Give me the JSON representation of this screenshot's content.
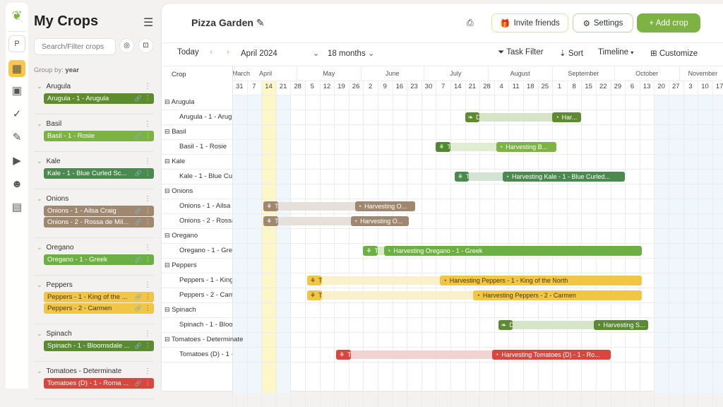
{
  "sidebar_rail": {
    "icons": [
      "sprout-logo-icon",
      "calendar-icon",
      "dashboard-icon",
      "check-circle-icon",
      "edit-icon",
      "video-tutorial-icon",
      "community-icon",
      "shop-icon"
    ],
    "profile_initial": "P"
  },
  "panel": {
    "title": "My Crops",
    "search_placeholder": "Search/Filter crops",
    "group_by_label": "Group by:",
    "group_by_value": "year",
    "groups": [
      {
        "name": "Arugula",
        "items": [
          {
            "label": "Arugula - 1 - Arugula",
            "color": "#5f8b2f"
          }
        ]
      },
      {
        "name": "Basil",
        "items": [
          {
            "label": "Basil - 1 - Rosie",
            "color": "#7cb342"
          }
        ]
      },
      {
        "name": "Kale",
        "items": [
          {
            "label": "Kale - 1 - Blue Curled Sc...",
            "color": "#4a8a4e"
          }
        ]
      },
      {
        "name": "Onions",
        "items": [
          {
            "label": "Onions - 1 - Ailsa Craig",
            "color": "#a08870"
          },
          {
            "label": "Onions - 2 - Rossa de Mil...",
            "color": "#a08870"
          }
        ]
      },
      {
        "name": "Oregano",
        "items": [
          {
            "label": "Oregano - 1 - Greek",
            "color": "#6cb044"
          }
        ]
      },
      {
        "name": "Peppers",
        "items": [
          {
            "label": "Peppers - 1 - King of the ...",
            "color": "#f1c644",
            "dark": true
          },
          {
            "label": "Peppers - 2 - Carmen",
            "color": "#f1c644",
            "dark": true
          }
        ]
      },
      {
        "name": "Spinach",
        "items": [
          {
            "label": "Spinach - 1 - Bloomsdale ...",
            "color": "#5a8b33"
          }
        ]
      },
      {
        "name": "Tomatoes - Determinate",
        "items": [
          {
            "label": "Tomatoes (D) - 1 - Roma ...",
            "color": "#d9463e"
          }
        ]
      }
    ]
  },
  "header": {
    "garden_name": "Pizza Garden",
    "invite_label": "Invite friends",
    "settings_label": "Settings",
    "add_crop_label": "+ Add crop"
  },
  "toolbar": {
    "today": "Today",
    "month": "April 2024",
    "range": "18 months",
    "task_filter": "Task Filter",
    "sort": "Sort",
    "view": "Timeline",
    "customize": "Customize"
  },
  "timeline": {
    "crop_header": "Crop",
    "start": "2024-03-31",
    "months": [
      {
        "name": "March",
        "start": "2024-03-01"
      },
      {
        "name": "April",
        "start": "2024-04-01"
      },
      {
        "name": "May",
        "start": "2024-05-01"
      },
      {
        "name": "June",
        "start": "2024-06-01"
      },
      {
        "name": "July",
        "start": "2024-07-01"
      },
      {
        "name": "August",
        "start": "2024-08-01"
      },
      {
        "name": "September",
        "start": "2024-09-01"
      },
      {
        "name": "October",
        "start": "2024-10-01"
      },
      {
        "name": "November",
        "start": "2024-11-01"
      }
    ],
    "weeks": [
      "31",
      "7",
      "14",
      "21",
      "28",
      "5",
      "12",
      "19",
      "26",
      "2",
      "9",
      "16",
      "23",
      "30",
      "7",
      "14",
      "21",
      "28",
      "4",
      "11",
      "18",
      "25",
      "1",
      "8",
      "15",
      "22",
      "29",
      "6",
      "13",
      "20",
      "27",
      "3",
      "10",
      "17"
    ],
    "today_week": "14",
    "shaded_weeks_before": [
      "31",
      "7",
      "21"
    ],
    "shaded_from": "2024-10-20",
    "rows": [
      {
        "group": "Arugula"
      },
      {
        "label": "Arugula - 1 - Arug",
        "color": "#5f8b2f",
        "light": "#d6e4c8",
        "task": {
          "icon": "leaf-icon",
          "label": "D",
          "start": "2024-07-21",
          "end": "2024-07-28"
        },
        "harvest": {
          "label": "Har...",
          "start": "2024-09-01",
          "end": "2024-09-15"
        }
      },
      {
        "group": "Basil"
      },
      {
        "label": "Basil - 1 - Rosie",
        "color": "#7cb342",
        "light": "#e1edd3",
        "task_color": "#4f8a2e",
        "task": {
          "icon": "transplant-icon",
          "label": "T",
          "start": "2024-07-07",
          "end": "2024-07-14"
        },
        "harvest": {
          "label": "Harvesting B...",
          "start": "2024-08-05",
          "end": "2024-09-03"
        }
      },
      {
        "group": "Kale"
      },
      {
        "label": "Kale - 1 - Blue Cu",
        "color": "#4a8a4e",
        "light": "#d4e4d4",
        "task": {
          "icon": "transplant-icon",
          "label": "T",
          "start": "2024-07-16",
          "end": "2024-07-23"
        },
        "harvest": {
          "label": "Harvesting Kale - 1 - Blue Curled...",
          "start": "2024-08-08",
          "end": "2024-10-06"
        }
      },
      {
        "group": "Onions"
      },
      {
        "label": "Onions - 1 - Ailsa",
        "color": "#a08870",
        "light": "#e6e0da",
        "task": {
          "icon": "transplant-icon",
          "label": "T",
          "start": "2024-04-15",
          "end": "2024-04-22"
        },
        "harvest": {
          "label": "Harvesting O...",
          "start": "2024-05-29",
          "end": "2024-06-27"
        }
      },
      {
        "label": "Onions - 2 - Rossa",
        "color": "#a08870",
        "light": "#e6e0da",
        "task": {
          "icon": "transplant-icon",
          "label": "T",
          "start": "2024-04-15",
          "end": "2024-04-22"
        },
        "harvest": {
          "label": "Harvesting O...",
          "start": "2024-05-27",
          "end": "2024-06-24"
        }
      },
      {
        "group": "Oregano"
      },
      {
        "label": "Oregano - 1 - Gre",
        "color": "#6cb044",
        "light": "#d9ebcb",
        "task": {
          "icon": "transplant-icon",
          "label": "T",
          "start": "2024-06-02",
          "end": "2024-06-09"
        },
        "harvest": {
          "label": "Harvesting Oregano - 1 - Greek",
          "start": "2024-06-12",
          "end": "2024-10-14"
        }
      },
      {
        "group": "Peppers"
      },
      {
        "label": "Peppers - 1 - King",
        "color": "#f1c644",
        "light": "#fbf0cc",
        "dark": true,
        "task": {
          "icon": "transplant-icon",
          "label": "T",
          "start": "2024-05-06",
          "end": "2024-05-13"
        },
        "harvest": {
          "label": "Harvesting Peppers - 1 - King of the North",
          "start": "2024-07-09",
          "end": "2024-10-14"
        }
      },
      {
        "label": "Peppers - 2 - Carm",
        "color": "#f1c644",
        "light": "#fbf0cc",
        "dark": true,
        "task": {
          "icon": "transplant-icon",
          "label": "T",
          "start": "2024-05-06",
          "end": "2024-05-13"
        },
        "harvest": {
          "label": "Harvesting Peppers - 2 - Carmen",
          "start": "2024-07-25",
          "end": "2024-10-14"
        }
      },
      {
        "group": "Spinach"
      },
      {
        "label": "Spinach - 1 - Bloo",
        "color": "#5a8b33",
        "light": "#d6e4c8",
        "task": {
          "icon": "leaf-icon",
          "label": "D",
          "start": "2024-08-06",
          "end": "2024-08-13"
        },
        "harvest": {
          "label": "Harvesting S...",
          "start": "2024-09-21",
          "end": "2024-10-17"
        }
      },
      {
        "group": "Tomatoes - Determinate"
      },
      {
        "label": "Tomatoes (D) - 1 -",
        "color": "#d9463e",
        "light": "#f3d3d1",
        "task": {
          "icon": "transplant-icon",
          "label": "T",
          "start": "2024-05-20",
          "end": "2024-05-27"
        },
        "harvest": {
          "label": "Harvesting Tomatoes (D) - 1 - Ro...",
          "start": "2024-08-03",
          "end": "2024-09-29"
        }
      }
    ]
  },
  "colors": {
    "accent": "#7cb342",
    "today": "#fdf6c9",
    "shade": "#f0f7fc"
  }
}
